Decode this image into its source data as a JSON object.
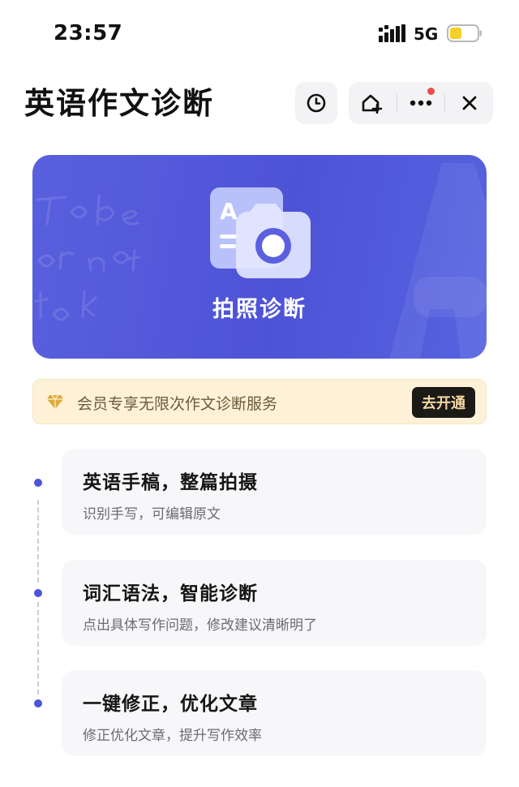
{
  "status_bar": {
    "time": "23:57",
    "network": "5G",
    "battery_color": "#f5cf2a"
  },
  "header": {
    "title": "英语作文诊断",
    "icons": [
      "history-icon",
      "add-to-home-icon",
      "more-icon",
      "close-icon"
    ]
  },
  "banner": {
    "label": "拍照诊断",
    "gradient": [
      "#5960de",
      "#4e53d6",
      "#5563e0"
    ],
    "icon": "camera-scan-icon"
  },
  "membership": {
    "text": "会员专享无限次作文诊断服务",
    "button_label": "去开通",
    "accent": "#e0a93a"
  },
  "features": [
    {
      "title": "英语手稿，整篇拍摄",
      "subtitle": "识别手写，可编辑原文"
    },
    {
      "title": "词汇语法，智能诊断",
      "subtitle": "点出具体写作问题，修改建议清晰明了"
    },
    {
      "title": "一键修正，优化文章",
      "subtitle": "修正优化文章，提升写作效率"
    }
  ],
  "colors": {
    "timeline_dot": "#4b55d8",
    "notification_dot": "#ee4b4b"
  }
}
